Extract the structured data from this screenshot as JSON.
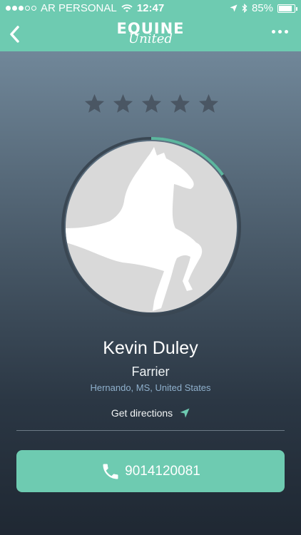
{
  "status_bar": {
    "carrier": "AR PERSONAL",
    "time": "12:47",
    "battery": "85%",
    "battery_level": 0.85,
    "signal_bars_filled": 3,
    "signal_bars_total": 5
  },
  "nav": {
    "logo_line1": "EQUINE",
    "logo_line2": "United",
    "back_icon": "chevron-left-icon",
    "more_icon": "more-horizontal-icon"
  },
  "profile": {
    "rating": 0,
    "rating_max": 5,
    "progress": 0.15,
    "name": "Kevin Duley",
    "role": "Farrier",
    "location": "Hernando,  MS,  United States"
  },
  "actions": {
    "directions_label": "Get directions",
    "phone": "9014120081"
  },
  "colors": {
    "accent": "#6ecbb1",
    "star_empty": "#4a5663",
    "location_text": "#8fb0cc"
  }
}
